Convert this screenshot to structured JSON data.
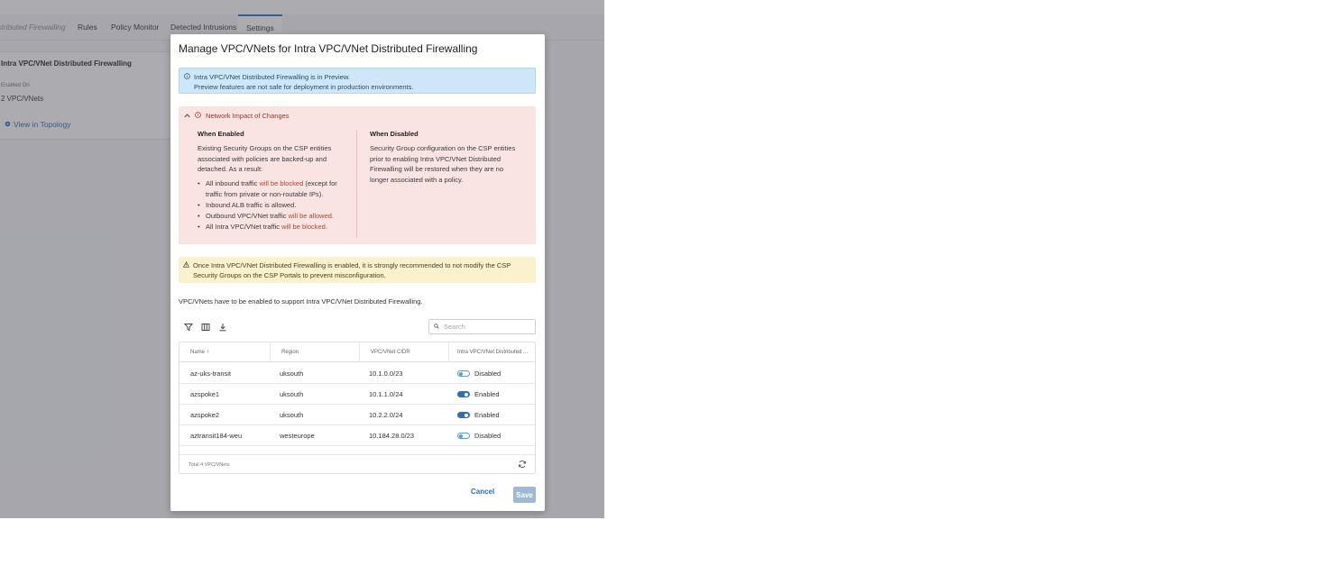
{
  "tabs": [
    {
      "label": "stributed Firewalling"
    },
    {
      "label": "Rules"
    },
    {
      "label": "Policy Monitor"
    },
    {
      "label": "Detected Intrusions"
    },
    {
      "label": "Settings"
    }
  ],
  "card": {
    "title": "Intra VPC/VNet Distributed Firewalling",
    "enabled_on_label": "Enabled On",
    "enabled_on_value": "2 VPC/VNets",
    "topology_link": "View in Topology"
  },
  "modal": {
    "title": "Manage VPC/VNets for Intra VPC/VNet Distributed Firewalling",
    "info_line1": "Intra VPC/VNet Distributed Firewalling is in Preview.",
    "info_line2": "Preview features are not safe for deployment in production environments.",
    "impact": {
      "heading": "Network Impact of Changes",
      "enabled_title": "When Enabled",
      "enabled_text": "Existing Security Groups on the CSP entities associated with policies are backed-up and detached. As a result:",
      "bullets": [
        {
          "pre": "All inbound traffic ",
          "red": "will be blocked",
          "post": " (except for traffic from private or non-routable IPs)."
        },
        {
          "pre": "Inbound ALB traffic is allowed.",
          "red": "",
          "post": ""
        },
        {
          "pre": "Outbound VPC/VNet traffic ",
          "red": "will be allowed.",
          "post": ""
        },
        {
          "pre": "All Intra VPC/VNet traffic ",
          "red": "will be blocked.",
          "post": ""
        }
      ],
      "disabled_title": "When Disabled",
      "disabled_text": "Security Group configuration on the CSP entities prior to enabling Intra VPC/VNet Distributed Firewalling will be restored when they are no longer associated with a policy."
    },
    "warning_line1": "Once Intra VPC/VNet Distributed Firewalling is enabled, it is strongly recommended to not modify the CSP",
    "warning_line2": "Security Groups on the CSP Portals to prevent misconfiguration.",
    "note": "VPC/VNets have to be enabled to support Intra VPC/VNet Distributed Firewalling.",
    "search_placeholder": "Search",
    "table": {
      "headers": [
        "Name",
        "Region",
        "VPC/VNet CIDR",
        "Intra VPC/VNet Distributed ..."
      ],
      "rows": [
        {
          "name": "az-uks-transit",
          "region": "uksouth",
          "cidr": "10.1.0.0/23",
          "status": "Disabled"
        },
        {
          "name": "azspoke1",
          "region": "uksouth",
          "cidr": "10.1.1.0/24",
          "status": "Enabled"
        },
        {
          "name": "azspoke2",
          "region": "uksouth",
          "cidr": "10.2.2.0/24",
          "status": "Enabled"
        },
        {
          "name": "aztransit184-weu",
          "region": "westeurope",
          "cidr": "10.184.28.0/23",
          "status": "Disabled"
        }
      ],
      "total": "Total 4 VPC/VNets"
    },
    "cancel_label": "Cancel",
    "save_label": "Save"
  },
  "colors": {
    "accent": "#2f6fb5",
    "info_bg": "#cde6f8",
    "impact_bg": "#f9e4e2",
    "warn_bg": "#fbf1cc"
  }
}
